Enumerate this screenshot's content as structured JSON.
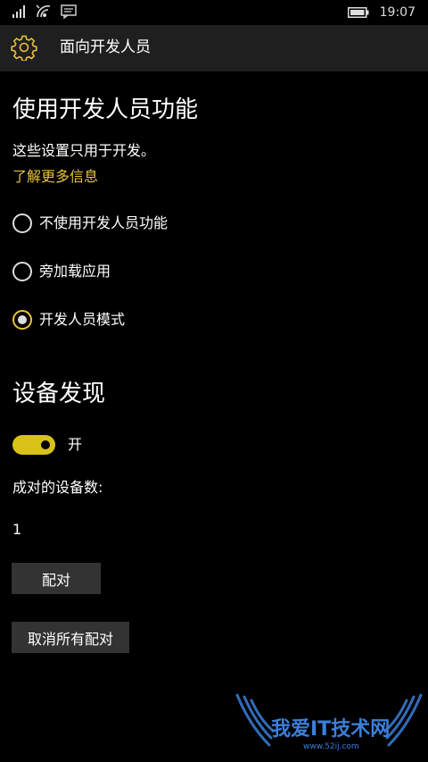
{
  "status_bar": {
    "time": "19:07",
    "icons": [
      "signal-icon",
      "wifi-icon",
      "message-icon",
      "battery-icon"
    ]
  },
  "header": {
    "title": "面向开发人员",
    "icon": "gear-icon"
  },
  "developer_features": {
    "title": "使用开发人员功能",
    "description": "这些设置只用于开发。",
    "learn_more": "了解更多信息",
    "options": [
      {
        "label": "不使用开发人员功能",
        "selected": false
      },
      {
        "label": "旁加载应用",
        "selected": false
      },
      {
        "label": "开发人员模式",
        "selected": true
      }
    ]
  },
  "device_discovery": {
    "title": "设备发现",
    "toggle_label": "开",
    "toggle_on": true,
    "paired_count_label": "成对的设备数:",
    "paired_count": "1",
    "pair_button": "配对",
    "unpair_all_button": "取消所有配对"
  },
  "colors": {
    "accent": "#e8c23a",
    "toggle_fill": "#d8c21a",
    "header_bg": "#1f1f1f",
    "button_bg": "#333333"
  },
  "watermark": {
    "text": "我爱IT技术网",
    "url": "www.52ij.com"
  }
}
